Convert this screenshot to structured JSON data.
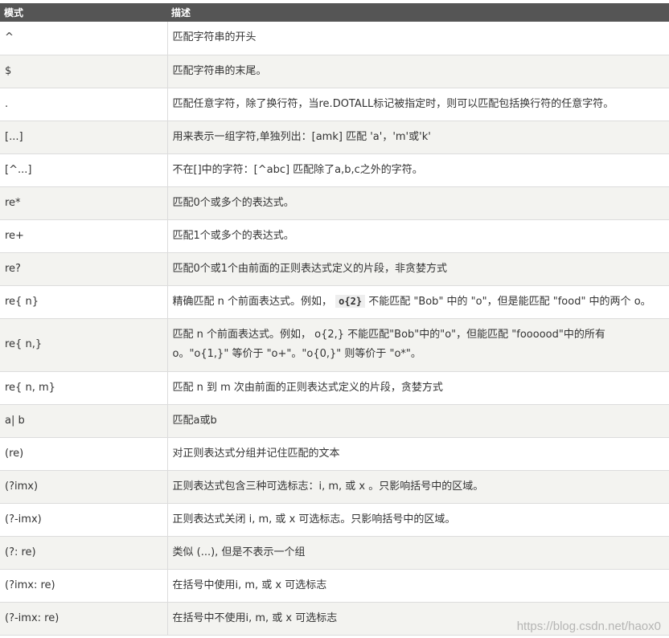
{
  "header": {
    "col_pattern": "模式",
    "col_desc": "描述"
  },
  "rows": [
    {
      "pattern": "^",
      "desc": "匹配字符串的开头"
    },
    {
      "pattern": "$",
      "desc": "匹配字符串的末尾。"
    },
    {
      "pattern": ".",
      "desc": "匹配任意字符，除了换行符，当re.DOTALL标记被指定时，则可以匹配包括换行符的任意字符。"
    },
    {
      "pattern": "[...]",
      "desc": "用来表示一组字符,单独列出：[amk] 匹配 'a'，'m'或'k'"
    },
    {
      "pattern": "[^...]",
      "desc": "不在[]中的字符：[^abc] 匹配除了a,b,c之外的字符。"
    },
    {
      "pattern": "re*",
      "desc": "匹配0个或多个的表达式。"
    },
    {
      "pattern": "re+",
      "desc": "匹配1个或多个的表达式。"
    },
    {
      "pattern": "re?",
      "desc": "匹配0个或1个由前面的正则表达式定义的片段，非贪婪方式"
    },
    {
      "pattern": "re{ n}",
      "desc_pre": "精确匹配 n 个前面表达式。例如，",
      "desc_code": "o{2}",
      "desc_post": "不能匹配 \"Bob\" 中的 \"o\"，但是能匹配 \"food\" 中的两个 o。"
    },
    {
      "pattern": "re{ n,}",
      "desc": "匹配 n 个前面表达式。例如， o{2,} 不能匹配\"Bob\"中的\"o\"，但能匹配 \"foooood\"中的所有 o。\"o{1,}\" 等价于 \"o+\"。\"o{0,}\" 则等价于 \"o*\"。"
    },
    {
      "pattern": "re{ n, m}",
      "desc": "匹配 n 到 m 次由前面的正则表达式定义的片段，贪婪方式"
    },
    {
      "pattern": "a| b",
      "desc": "匹配a或b"
    },
    {
      "pattern": "(re)",
      "desc": "对正则表达式分组并记住匹配的文本"
    },
    {
      "pattern": "(?imx)",
      "desc": "正则表达式包含三种可选标志：i, m, 或 x 。只影响括号中的区域。"
    },
    {
      "pattern": "(?-imx)",
      "desc": "正则表达式关闭 i, m, 或 x 可选标志。只影响括号中的区域。"
    },
    {
      "pattern": "(?: re)",
      "desc": "类似 (...), 但是不表示一个组"
    },
    {
      "pattern": "(?imx: re)",
      "desc": "在括号中使用i, m, 或 x 可选标志"
    },
    {
      "pattern": "(?-imx: re)",
      "desc": "在括号中不使用i, m, 或 x 可选标志"
    }
  ],
  "watermark": "https://blog.csdn.net/haox0"
}
